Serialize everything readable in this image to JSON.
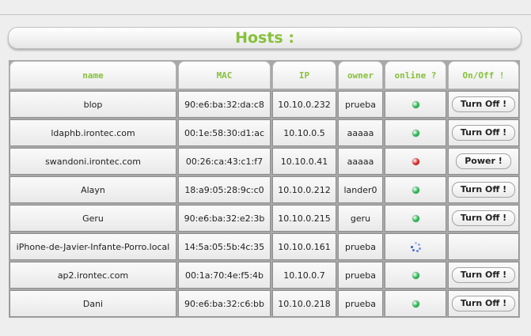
{
  "page": {
    "title": "Hosts :"
  },
  "table": {
    "headers": {
      "name": "name",
      "mac": "MAC",
      "ip": "IP",
      "owner": "owner",
      "online": "online ?",
      "onoff": "On/Off !"
    },
    "status_colors": {
      "online": "#22b14c",
      "offline": "#d42020",
      "loading": "#2a5cd6"
    },
    "rows": [
      {
        "name": "blop",
        "mac": "90:e6:ba:32:da:c8",
        "ip": "10.10.0.232",
        "owner": "prueba",
        "status": "online",
        "action": "Turn Off !"
      },
      {
        "name": "ldaphb.irontec.com",
        "mac": "00:1e:58:30:d1:ac",
        "ip": "10.10.0.5",
        "owner": "aaaaa",
        "status": "online",
        "action": "Turn Off !"
      },
      {
        "name": "swandoni.irontec.com",
        "mac": "00:26:ca:43:c1:f7",
        "ip": "10.10.0.41",
        "owner": "aaaaa",
        "status": "offline",
        "action": "Power !"
      },
      {
        "name": "Alayn",
        "mac": "18:a9:05:28:9c:c0",
        "ip": "10.10.0.212",
        "owner": "lander0",
        "status": "online",
        "action": "Turn Off !"
      },
      {
        "name": "Geru",
        "mac": "90:e6:ba:32:e2:3b",
        "ip": "10.10.0.215",
        "owner": "geru",
        "status": "online",
        "action": "Turn Off !"
      },
      {
        "name": "iPhone-de-Javier-Infante-Porro.local",
        "mac": "14:5a:05:5b:4c:35",
        "ip": "10.10.0.161",
        "owner": "prueba",
        "status": "loading",
        "action": ""
      },
      {
        "name": "ap2.irontec.com",
        "mac": "00:1a:70:4e:f5:4b",
        "ip": "10.10.0.7",
        "owner": "prueba",
        "status": "online",
        "action": "Turn Off !"
      },
      {
        "name": "Dani",
        "mac": "90:e6:ba:32:c6:bb",
        "ip": "10.10.0.218",
        "owner": "prueba",
        "status": "online",
        "action": "Turn Off !"
      }
    ]
  }
}
